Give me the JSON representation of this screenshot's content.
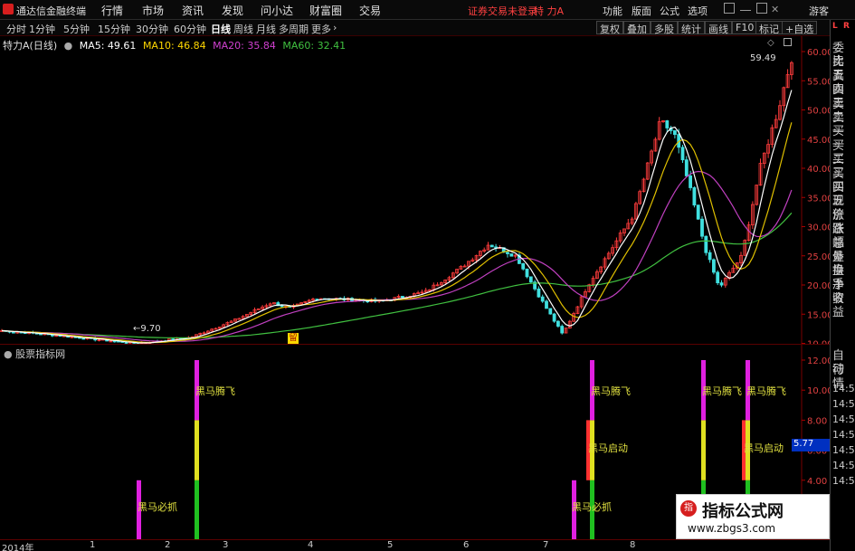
{
  "app": {
    "title": "通达信金融终端",
    "stock_name": "特 力A",
    "login_status": "证券交易未登录",
    "user": "游客"
  },
  "menu": [
    "行情",
    "市场",
    "资讯",
    "发现",
    "问小达",
    "财富圈",
    "交易"
  ],
  "right_menu": [
    "功能",
    "版面",
    "公式",
    "选项"
  ],
  "periods": [
    "分时",
    "1分钟",
    "5分钟",
    "15分钟",
    "30分钟",
    "60分钟",
    "日线",
    "周线",
    "月线",
    "多周期",
    "更多"
  ],
  "active_period": "日线",
  "tools": [
    "复权",
    "叠加",
    "多股",
    "统计",
    "画线",
    "F10",
    "标记",
    "+自选"
  ],
  "main_chart": {
    "title": "特力A(日线)",
    "ma": [
      {
        "label": "MA5: 49.61",
        "color": "#ffffff"
      },
      {
        "label": "MA10: 46.84",
        "color": "#ffd700"
      },
      {
        "label": "MA20: 35.84",
        "color": "#d040d0"
      },
      {
        "label": "MA60: 32.41",
        "color": "#40c040"
      }
    ],
    "last_price": "59.49",
    "low_label": "9.70",
    "y_ticks": [
      "60.00",
      "55.00",
      "50.00",
      "45.00",
      "40.00",
      "35.00",
      "30.00",
      "25.00",
      "20.00",
      "15.00",
      "10.00"
    ],
    "marker": "留"
  },
  "indicator": {
    "title": "股票指标网",
    "y_ticks": [
      "12.00",
      "10.00",
      "8.00",
      "6.00",
      "4.00",
      "2.00"
    ],
    "current_value": "5.77",
    "label_fly": "黑马腾飞",
    "label_start": "黑马启动",
    "label_catch": "黑马必抓"
  },
  "time_axis": [
    "2014年",
    "1",
    "2",
    "3",
    "4",
    "5",
    "6",
    "7",
    "8"
  ],
  "side_panel": [
    "委比",
    "卖五",
    "卖四",
    "卖三",
    "卖二",
    "卖一",
    "买一",
    "买二",
    "买三",
    "买四",
    "买五",
    "现价",
    "涨跌",
    "涨幅",
    "总量",
    "外盘",
    "换手",
    "净资",
    "收益"
  ],
  "side_panel2": [
    "自动",
    "行情"
  ],
  "side_times": [
    "14:50",
    "14:50",
    "14:50",
    "14:50",
    "14:50",
    "14:50",
    "14:50"
  ],
  "watermark": {
    "title": "指标公式网",
    "url": "www.zbgs3.com",
    "icon": "指"
  }
}
